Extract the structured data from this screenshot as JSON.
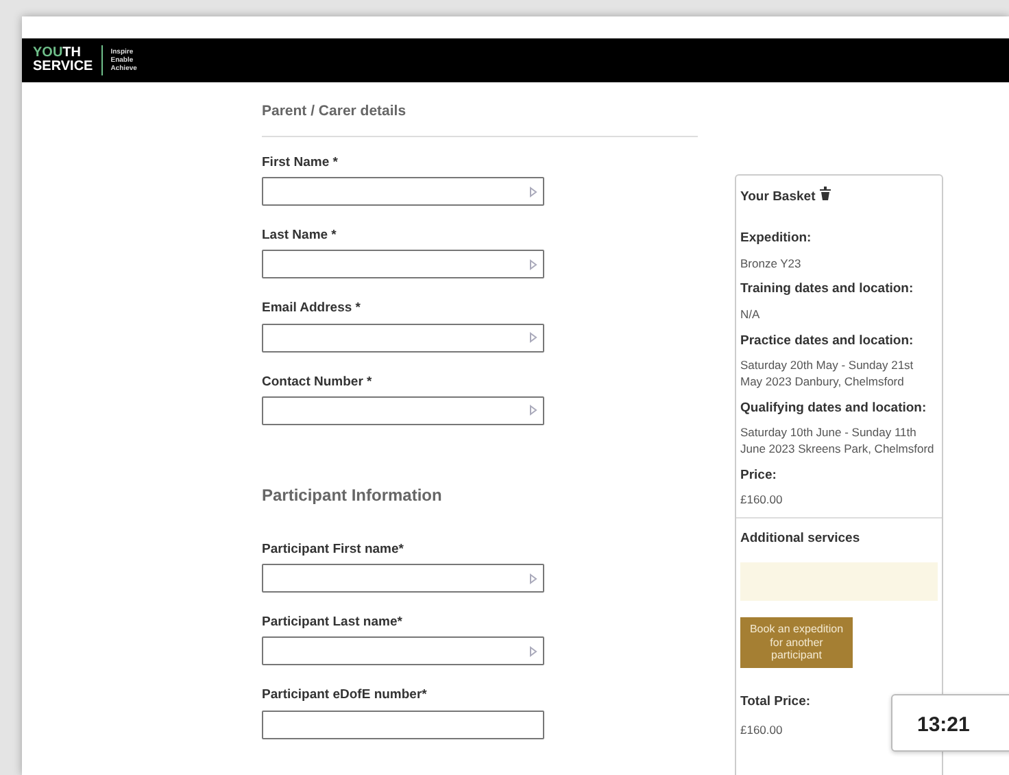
{
  "header": {
    "logo_accent": "YOU",
    "logo_rest": "TH",
    "logo_second": "SERVICE",
    "tagline": [
      "Inspire",
      "Enable",
      "Achieve"
    ]
  },
  "sections": [
    {
      "title": "Parent / Carer details",
      "divider": true,
      "fields": [
        {
          "label": "First Name *",
          "autofill_icon": true
        },
        {
          "label": "Last Name *",
          "autofill_icon": true
        },
        {
          "label": "Email Address *",
          "autofill_icon": true
        },
        {
          "label": "Contact Number *",
          "autofill_icon": true
        }
      ]
    },
    {
      "title": "Participant Information",
      "divider": false,
      "fields": [
        {
          "label": "Participant First name*",
          "autofill_icon": true
        },
        {
          "label": "Participant Last name*",
          "autofill_icon": true
        },
        {
          "label": "Participant eDofE number*",
          "autofill_icon": false
        }
      ]
    }
  ],
  "basket": {
    "title": "Your Basket",
    "details": [
      {
        "label": "Expedition:",
        "value": "Bronze Y23"
      },
      {
        "label": "Training dates and location:",
        "value": "N/A"
      },
      {
        "label": "Practice dates and location:",
        "value": "Saturday 20th May - Sunday 21st May 2023 Danbury, Chelmsford"
      },
      {
        "label": "Qualifying dates and location:",
        "value": "Saturday 10th June - Sunday 11th June 2023 Skreens Park, Chelmsford"
      },
      {
        "label": "Price:",
        "value": "£160.00"
      }
    ],
    "additional_title": "Additional services",
    "book_button": "Book an expedition for another participant",
    "total_label": "Total Price:",
    "total_value": "£160.00"
  },
  "clock": "13:21"
}
